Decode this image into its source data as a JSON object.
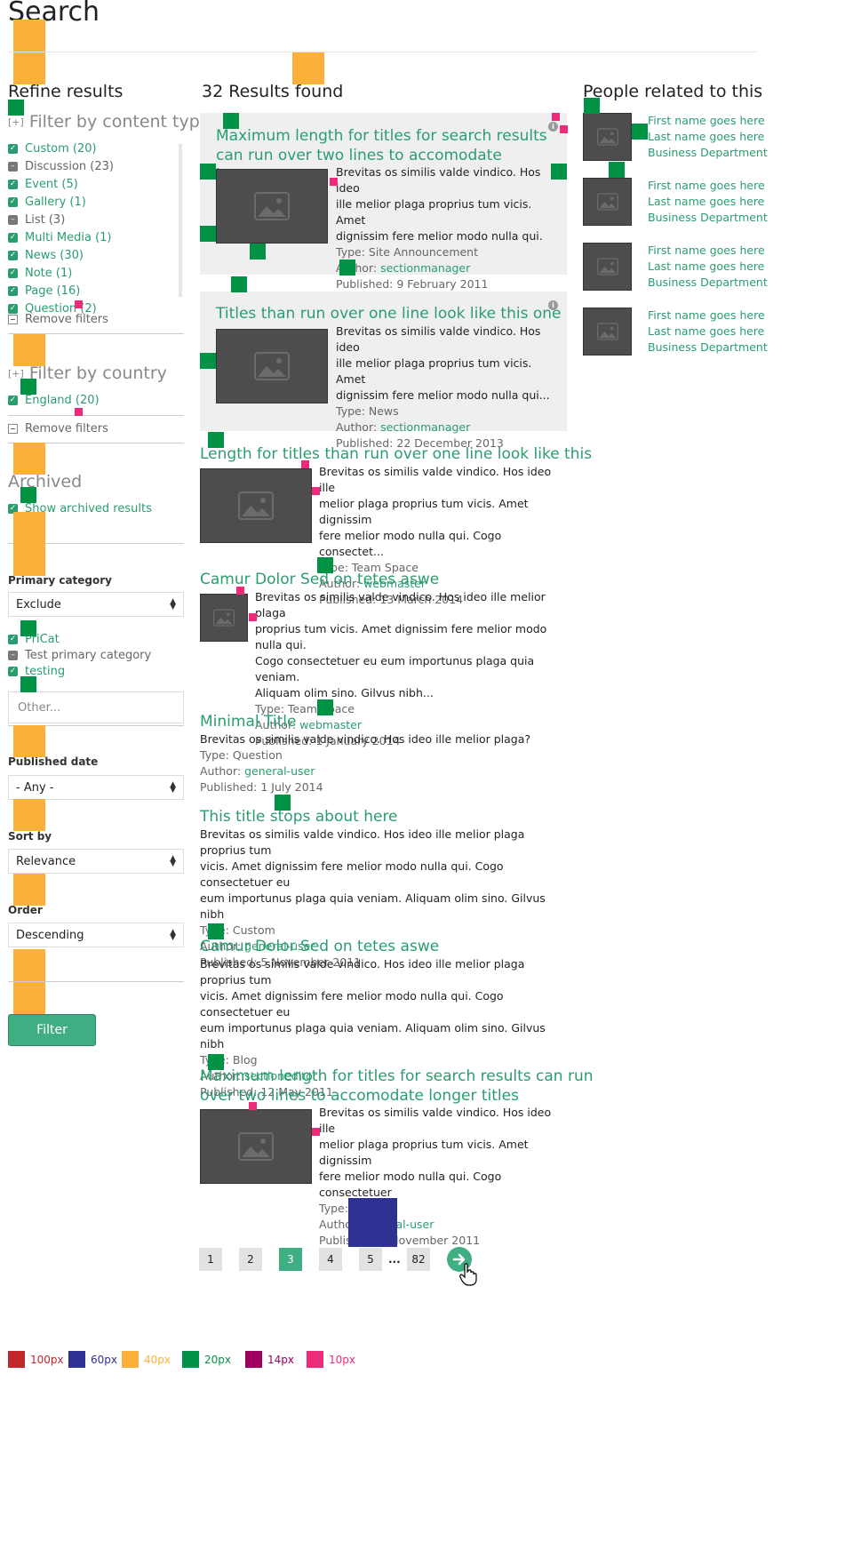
{
  "page": {
    "title": "Search"
  },
  "refine": {
    "heading": "Refine results",
    "content_type": {
      "heading": "Filter by content type",
      "toggle": "[+]",
      "items": [
        {
          "label": "Custom (20)",
          "checked": true
        },
        {
          "label": "Discussion (23)",
          "checked": false
        },
        {
          "label": "Event (5)",
          "checked": true
        },
        {
          "label": "Gallery (1)",
          "checked": true
        },
        {
          "label": "List (3)",
          "checked": false
        },
        {
          "label": "Multi Media (1)",
          "checked": true
        },
        {
          "label": "News (30)",
          "checked": true
        },
        {
          "label": "Note (1)",
          "checked": true
        },
        {
          "label": "Page (16)",
          "checked": true
        },
        {
          "label": "Question (2)",
          "checked": true
        }
      ],
      "remove": "Remove filters"
    },
    "country": {
      "heading": "Filter by country",
      "toggle": "[+]",
      "items": [
        {
          "label": "England (20)",
          "checked": true
        }
      ],
      "remove": "Remove filters"
    },
    "archived": {
      "heading": "Archived",
      "checkbox": "Show archived results"
    },
    "primary_category": {
      "label": "Primary category",
      "select": "Exclude",
      "items": [
        {
          "label": "PriCat",
          "checked": true
        },
        {
          "label": "Test primary category",
          "checked": false
        },
        {
          "label": "testing",
          "checked": true
        }
      ],
      "other_placeholder": "Other..."
    },
    "published_date": {
      "label": "Published date",
      "select": "- Any -"
    },
    "sort_by": {
      "label": "Sort by",
      "select": "Relevance"
    },
    "order": {
      "label": "Order",
      "select": "Descending"
    },
    "filter_button": "Filter"
  },
  "results": {
    "heading": "32 Results found",
    "items": [
      {
        "title_l1": "Maximum length for titles for search results",
        "title_l2": "can run over two lines to accomodate longer...",
        "text": [
          "Brevitas os similis valde vindico. Hos ideo",
          "ille melior plaga proprius tum vicis. Amet",
          "dignissim fere melior modo nulla qui."
        ],
        "type": "Type: Site Announcement",
        "author_label": "Author: ",
        "author": "sectionmanager",
        "published": "Published: 9 February 2011"
      },
      {
        "title_l1": "Titles than run over one line look like this one",
        "text": [
          "Brevitas os similis valde vindico. Hos ideo",
          "ille melior plaga proprius tum vicis. Amet",
          "dignissim fere melior modo nulla qui..."
        ],
        "type": "Type: News",
        "author_label": "Author: ",
        "author": "sectionmanager",
        "published": "Published: 22 December 2013"
      },
      {
        "title_l1": "Length for titles than run over one line look like this",
        "text": [
          "Brevitas os similis valde vindico. Hos ideo ille",
          "melior plaga proprius tum vicis. Amet dignissim",
          "fere melior modo nulla qui. Cogo consectet..."
        ],
        "type": "Type: Team Space",
        "author_label": "Author: ",
        "author": "webmaster",
        "published": "Published: 13 March 2014"
      },
      {
        "title_l1": "Camur Dolor Sed on tetes aswe",
        "text": [
          "Brevitas os similis valde vindico. Hos ideo ille melior plaga",
          "proprius tum vicis. Amet dignissim fere melior modo nulla qui.",
          "Cogo consectetuer eu eum importunus plaga quia veniam.",
          "Aliquam olim sino. Gilvus nibh..."
        ],
        "type": "Type: Team Space",
        "author_label": "Author: ",
        "author": "webmaster",
        "published": "Published: 1 January 2014"
      },
      {
        "title_l1": "Minimal Title",
        "text": [
          "Brevitas os similis valde vindico. Hos ideo ille melior plaga?"
        ],
        "type": "Type: Question",
        "author_label": "Author: ",
        "author": "general-user",
        "published": "Published: 1 July 2014"
      },
      {
        "title_l1": "This title stops about here",
        "text": [
          "Brevitas os similis valde vindico. Hos ideo ille melior plaga proprius tum",
          "vicis. Amet dignissim fere melior modo nulla qui. Cogo consectetuer eu",
          "eum importunus plaga quia veniam. Aliquam olim sino. Gilvus nibh"
        ],
        "type": "Type: Custom",
        "author_label": "Author: ",
        "author": "general-user",
        "published": "Published: 5 November 2011"
      },
      {
        "title_l1": "Camur Dolor Sed on tetes aswe",
        "text": [
          "Brevitas os similis valde vindico. Hos ideo ille melior plaga proprius tum",
          "vicis. Amet dignissim fere melior modo nulla qui. Cogo consectetuer eu",
          "eum importunus plaga quia veniam. Aliquam olim sino. Gilvus nibh"
        ],
        "type": "Type: Blog",
        "author_label": "Author: ",
        "author": "sectioneditor",
        "published": "Published: 12 May 2011"
      },
      {
        "title_l1": "Maximum length for titles for search results can run",
        "title_l2": "over two lines to accomodate longer titles",
        "text": [
          "Brevitas os similis valde vindico. Hos ideo ille",
          "melior plaga proprius tum vicis. Amet dignissim",
          "fere melior modo nulla qui. Cogo consectetuer"
        ],
        "type": "Type: Custom",
        "author_label": "Author: ",
        "author": "general-user",
        "published": "Published: 5 November 2011"
      }
    ]
  },
  "pagination": {
    "pages": [
      "1",
      "2",
      "3",
      "4",
      "5"
    ],
    "ellipsis": "...",
    "last": "82",
    "active": "3"
  },
  "people": {
    "heading": "People related to this",
    "items": [
      {
        "first": "First name goes here",
        "last": "Last name goes here",
        "dept": "Business Department"
      },
      {
        "first": "First name goes here",
        "last": "Last name goes here",
        "dept": "Business Department"
      },
      {
        "first": "First name goes here",
        "last": "Last name goes here",
        "dept": "Business Department"
      },
      {
        "first": "First name goes here",
        "last": "Last name goes here",
        "dept": "Business Department"
      }
    ]
  },
  "legend": [
    {
      "label": "100px",
      "color": "#c1272d"
    },
    {
      "label": "60px",
      "color": "#2e3192"
    },
    {
      "label": "40px",
      "color": "#fbb03b"
    },
    {
      "label": "20px",
      "color": "#009245"
    },
    {
      "label": "14px",
      "color": "#9e005d"
    },
    {
      "label": "10px",
      "color": "#ee2a7b"
    }
  ]
}
